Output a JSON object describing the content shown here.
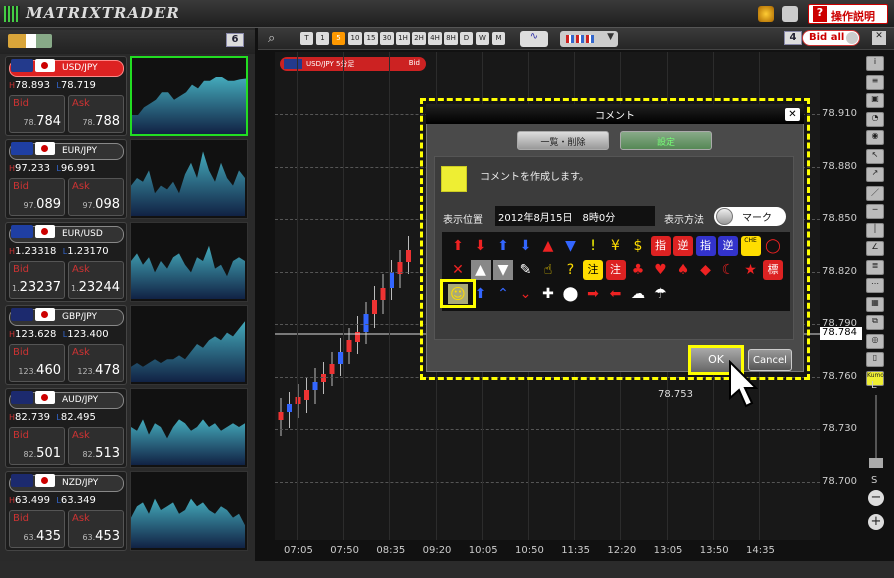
{
  "app": {
    "title": "MATRIXTRADER",
    "help": "操作説明"
  },
  "left": {
    "count": "6",
    "pairs": [
      {
        "name": "USD/JPY",
        "high": "78.893",
        "low": "78.719",
        "bid_big": "784",
        "bid_small": "78.",
        "ask_big": "788",
        "ask_small": "78.",
        "flag": "#233a8c",
        "active": true,
        "spark": [
          0.25,
          0.25,
          0.35,
          0.4,
          0.45,
          0.55,
          0.55,
          0.45,
          0.5,
          0.55,
          0.65,
          0.6,
          0.7,
          0.7,
          0.75,
          0.75,
          0.7,
          0.7,
          0.72,
          0.73
        ]
      },
      {
        "name": "EUR/JPY",
        "high": "97.233",
        "low": "96.991",
        "bid_big": "089",
        "bid_small": "97.",
        "ask_big": "098",
        "ask_small": "97.",
        "flag": "#1f3fa3",
        "spark": [
          0.4,
          0.5,
          0.45,
          0.6,
          0.3,
          0.4,
          0.35,
          0.45,
          0.3,
          0.55,
          0.7,
          0.5,
          0.85,
          0.6,
          0.45,
          0.7,
          0.5,
          0.4,
          0.6,
          0.5
        ]
      },
      {
        "name": "EUR/USD",
        "high": "1.23318",
        "low": "1.23170",
        "bid_big": "23237",
        "bid_small": "1.",
        "ask_big": "23244",
        "ask_small": "1.",
        "flag": "#1f3fa3",
        "spark": [
          0.5,
          0.6,
          0.45,
          0.55,
          0.35,
          0.5,
          0.4,
          0.55,
          0.6,
          0.45,
          0.35,
          0.55,
          0.5,
          0.7,
          0.4,
          0.45,
          0.3,
          0.5,
          0.55,
          0.5
        ]
      },
      {
        "name": "GBP/JPY",
        "high": "123.628",
        "low": "123.400",
        "bid_big": "460",
        "bid_small": "123.",
        "ask_big": "478",
        "ask_small": "123.",
        "flag": "#1c2a6e",
        "spark": [
          0.2,
          0.25,
          0.2,
          0.25,
          0.3,
          0.25,
          0.3,
          0.3,
          0.35,
          0.3,
          0.4,
          0.5,
          0.45,
          0.55,
          0.6,
          0.55,
          0.65,
          0.6,
          0.7,
          0.8
        ]
      },
      {
        "name": "AUD/JPY",
        "high": "82.739",
        "low": "82.495",
        "bid_big": "501",
        "bid_small": "82.",
        "ask_big": "513",
        "ask_small": "82.",
        "flag": "#1c2a6e",
        "spark": [
          0.5,
          0.45,
          0.6,
          0.4,
          0.55,
          0.5,
          0.35,
          0.5,
          0.6,
          0.55,
          0.45,
          0.5,
          0.6,
          0.5,
          0.55,
          0.45,
          0.5,
          0.55,
          0.5,
          0.55
        ]
      },
      {
        "name": "NZD/JPY",
        "high": "63.499",
        "low": "63.349",
        "bid_big": "435",
        "bid_small": "63.",
        "ask_big": "453",
        "ask_small": "63.",
        "flag": "#1c2a6e",
        "spark": [
          0.4,
          0.55,
          0.6,
          0.45,
          0.65,
          0.5,
          0.55,
          0.6,
          0.45,
          0.5,
          0.65,
          0.55,
          0.6,
          0.5,
          0.45,
          0.55,
          0.5,
          0.4,
          0.45,
          0.3
        ]
      }
    ]
  },
  "toolbar": {
    "frames": [
      "T",
      "1",
      "5",
      "10",
      "15",
      "30",
      "1H",
      "2H",
      "4H",
      "8H",
      "D",
      "W",
      "M"
    ],
    "active": "5",
    "count": "4",
    "bid_all": "Bid all"
  },
  "chart": {
    "symbol": "USD/JPY 5分足",
    "side": "Bid",
    "yticks": [
      "78.910",
      "78.880",
      "78.850",
      "78.820",
      "78.790",
      "78.760",
      "78.730",
      "78.700"
    ],
    "current": "78.784",
    "xticks": [
      "07:05",
      "07:50",
      "08:35",
      "09:20",
      "10:05",
      "10:50",
      "11:35",
      "12:20",
      "13:05",
      "13:50",
      "14:35"
    ],
    "low_label": "78.753",
    "zoom_l": "L",
    "zoom_s": "S"
  },
  "dialog": {
    "title": "コメント",
    "tab_list": "一覧・削除",
    "tab_set": "設定",
    "message": "コメントを作成します。",
    "pos_label": "表示位置",
    "pos_value": "2012年8月15日　8時0分",
    "method_label": "表示方法",
    "method_value": "マーク",
    "ok": "OK",
    "cancel": "Cancel",
    "icons": [
      [
        "⬆",
        "#e22"
      ],
      [
        "⬇",
        "#e22"
      ],
      [
        "⬆",
        "#36f"
      ],
      [
        "⬇",
        "#36f"
      ],
      [
        "▲",
        "#e22"
      ],
      [
        "▼",
        "#36f"
      ],
      [
        "!",
        "#ff0"
      ],
      [
        "¥",
        "#fd0"
      ],
      [
        "$",
        "#fd0"
      ],
      [
        "指",
        "#fff"
      ],
      [
        "逆",
        "#fff"
      ],
      [
        "指",
        "#fff"
      ],
      [
        "逆",
        "#fff"
      ],
      [
        "CHE",
        "#000"
      ],
      [
        "◯",
        "#e22"
      ],
      [
        "✕",
        "#e22"
      ],
      [
        "▲",
        "#fff"
      ],
      [
        "▼",
        "#fff"
      ],
      [
        "✎",
        "#fff"
      ],
      [
        "☝",
        "#fd0"
      ],
      [
        "?",
        "#fd0"
      ],
      [
        "注",
        "#000"
      ],
      [
        "注",
        "#fff"
      ],
      [
        "♣",
        "#e22"
      ],
      [
        "♥",
        "#e22"
      ],
      [
        "♠",
        "#e22"
      ],
      [
        "◆",
        "#e22"
      ],
      [
        "☾",
        "#e22"
      ],
      [
        "★",
        "#e22"
      ],
      [
        "標",
        "#fff"
      ],
      [
        "☺",
        "#fd0"
      ],
      [
        "⬆",
        "#36f"
      ],
      [
        "⌃",
        "#36f"
      ],
      [
        "⌄",
        "#e22"
      ],
      [
        "✚",
        "#fff"
      ],
      [
        "⬤",
        "#fff"
      ],
      [
        "➡",
        "#e22"
      ],
      [
        "⬅",
        "#e22"
      ],
      [
        "☁",
        "#fff"
      ],
      [
        "☂",
        "#fff"
      ]
    ]
  }
}
